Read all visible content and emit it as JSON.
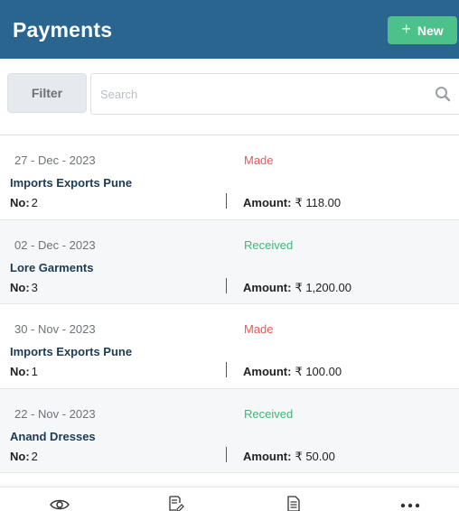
{
  "header": {
    "title": "Payments",
    "new_label": "New",
    "background": "#2a6590",
    "accent": "#4cc18a"
  },
  "toolbar": {
    "filter_label": "Filter",
    "search_placeholder": "Search",
    "search_value": ""
  },
  "payments": [
    {
      "date": "27 - Dec - 2023",
      "status": "Made",
      "party": "Imports Exports Pune",
      "no_label": "No:",
      "no": "2",
      "amount_label": "Amount:",
      "amount": "₹ 118.00"
    },
    {
      "date": "02 - Dec - 2023",
      "status": "Received",
      "party": "Lore Garments",
      "no_label": "No:",
      "no": "3",
      "amount_label": "Amount:",
      "amount": "₹ 1,200.00"
    },
    {
      "date": "30 - Nov - 2023",
      "status": "Made",
      "party": "Imports Exports Pune",
      "no_label": "No:",
      "no": "1",
      "amount_label": "Amount:",
      "amount": "₹ 100.00"
    },
    {
      "date": "22 - Nov - 2023",
      "status": "Received",
      "party": "Anand Dresses",
      "no_label": "No:",
      "no": "2",
      "amount_label": "Amount:",
      "amount": "₹ 50.00"
    }
  ],
  "status_colors": {
    "Made": "#e45a5a",
    "Received": "#3fb877"
  },
  "bottom_nav": [
    {
      "icon": "eye-icon"
    },
    {
      "icon": "document-edit-icon"
    },
    {
      "icon": "document-icon"
    },
    {
      "icon": "more-icon"
    }
  ]
}
